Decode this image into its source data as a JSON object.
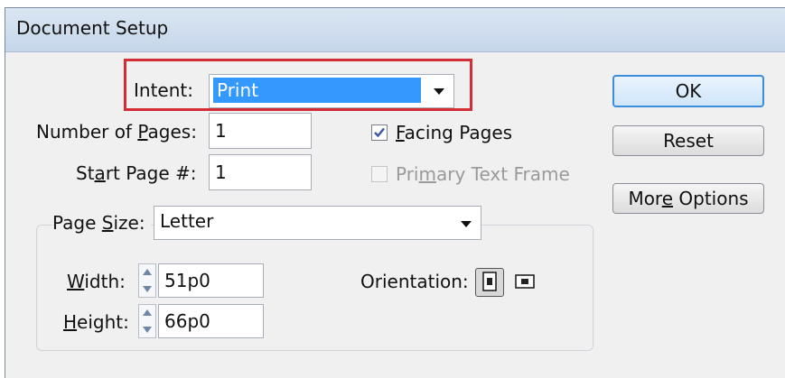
{
  "dialog": {
    "title": "Document Setup"
  },
  "intent": {
    "label": "Intent:",
    "value": "Print"
  },
  "pages": {
    "number_label": "Number of Pages:",
    "number_value": "1",
    "start_label": "Start Page #:",
    "start_value": "1"
  },
  "options": {
    "facing_pages": {
      "label": "Facing Pages",
      "checked": true
    },
    "primary_text_frame": {
      "label": "Primary Text Frame",
      "checked": false,
      "disabled": true
    }
  },
  "page_size": {
    "label": "Page Size:",
    "value": "Letter"
  },
  "dimensions": {
    "width_label": "Width:",
    "width_value": "51p0",
    "height_label": "Height:",
    "height_value": "66p0"
  },
  "orientation": {
    "label": "Orientation:",
    "selected": "portrait",
    "icons": [
      "portrait-icon",
      "landscape-icon"
    ]
  },
  "buttons": {
    "ok": "OK",
    "reset": "Reset",
    "more_options": "More Options"
  },
  "colors": {
    "highlight_border": "#d32e35",
    "selection": "#3399ff",
    "ok_border": "#3c8dde"
  }
}
